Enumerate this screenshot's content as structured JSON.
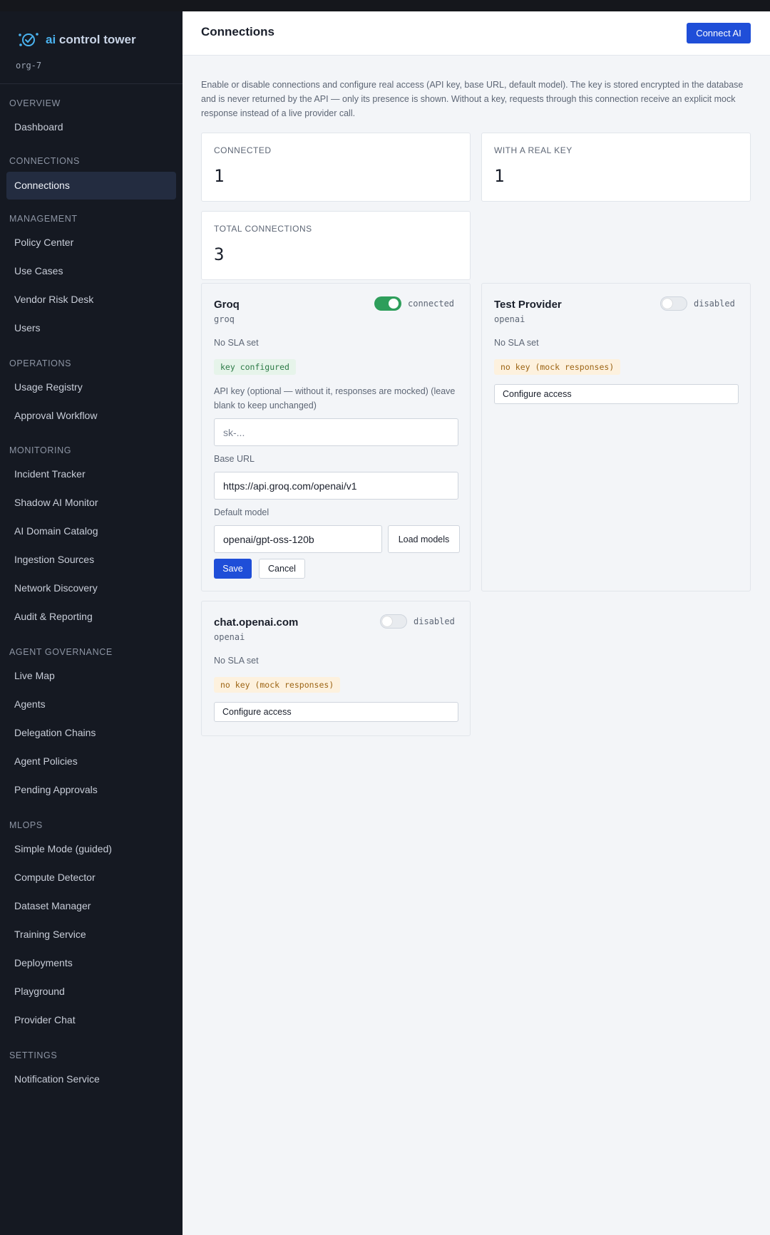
{
  "app": {
    "brand_prefix": "ai",
    "brand_rest": " control tower",
    "org": "org-7"
  },
  "sidebar": {
    "sections": [
      {
        "label": "OVERVIEW",
        "items": [
          {
            "label": "Dashboard"
          }
        ]
      },
      {
        "label": "CONNECTIONS",
        "items": [
          {
            "label": "Connections",
            "active": true
          }
        ]
      },
      {
        "label": "MANAGEMENT",
        "items": [
          {
            "label": "Policy Center"
          },
          {
            "label": "Use Cases"
          },
          {
            "label": "Vendor Risk Desk"
          },
          {
            "label": "Users"
          }
        ]
      },
      {
        "label": "OPERATIONS",
        "items": [
          {
            "label": "Usage Registry"
          },
          {
            "label": "Approval Workflow"
          }
        ]
      },
      {
        "label": "MONITORING",
        "items": [
          {
            "label": "Incident Tracker"
          },
          {
            "label": "Shadow AI Monitor"
          },
          {
            "label": "AI Domain Catalog"
          },
          {
            "label": "Ingestion Sources"
          },
          {
            "label": "Network Discovery"
          },
          {
            "label": "Audit & Reporting"
          }
        ]
      },
      {
        "label": "AGENT GOVERNANCE",
        "items": [
          {
            "label": "Live Map"
          },
          {
            "label": "Agents"
          },
          {
            "label": "Delegation Chains"
          },
          {
            "label": "Agent Policies"
          },
          {
            "label": "Pending Approvals"
          }
        ]
      },
      {
        "label": "MLOPS",
        "items": [
          {
            "label": "Simple Mode (guided)"
          },
          {
            "label": "Compute Detector"
          },
          {
            "label": "Dataset Manager"
          },
          {
            "label": "Training Service"
          },
          {
            "label": "Deployments"
          },
          {
            "label": "Playground"
          },
          {
            "label": "Provider Chat"
          }
        ]
      },
      {
        "label": "SETTINGS",
        "items": [
          {
            "label": "Notification Service"
          }
        ]
      }
    ]
  },
  "header": {
    "title": "Connections",
    "connect_label": "Connect AI"
  },
  "description": "Enable or disable connections and configure real access (API key, base URL, default model). The key is stored encrypted in the database and is never returned by the API — only its presence is shown. Without a key, requests through this connection receive an explicit mock response instead of a live provider call.",
  "stats": {
    "connected": {
      "label": "CONNECTED",
      "value": "1"
    },
    "real_key": {
      "label": "WITH A REAL KEY",
      "value": "1"
    },
    "total": {
      "label": "TOTAL CONNECTIONS",
      "value": "3"
    }
  },
  "cards": {
    "groq": {
      "title": "Groq",
      "kind": "groq",
      "enabled": true,
      "status": "connected",
      "sla": "No SLA set",
      "badge": "key configured",
      "api_key_label": "API key (optional — without it, responses are mocked) (leave blank to keep unchanged)",
      "api_key_placeholder": "sk-...",
      "base_url_label": "Base URL",
      "base_url_value": "https://api.groq.com/openai/v1",
      "model_label": "Default model",
      "model_value": "openai/gpt-oss-120b",
      "load_models_label": "Load models",
      "save_label": "Save",
      "cancel_label": "Cancel"
    },
    "test_provider": {
      "title": "Test Provider",
      "kind": "openai",
      "enabled": false,
      "status": "disabled",
      "sla": "No SLA set",
      "badge": "no key (mock responses)",
      "configure_label": "Configure access"
    },
    "chat_openai": {
      "title": "chat.openai.com",
      "kind": "openai",
      "enabled": false,
      "status": "disabled",
      "sla": "No SLA set",
      "badge": "no key (mock responses)",
      "configure_label": "Configure access"
    }
  },
  "colors": {
    "accent": "#1f4ed8",
    "sidebar_bg": "#151922",
    "toggle_on": "#2e9e5b",
    "brand": "#4ab3f0"
  }
}
